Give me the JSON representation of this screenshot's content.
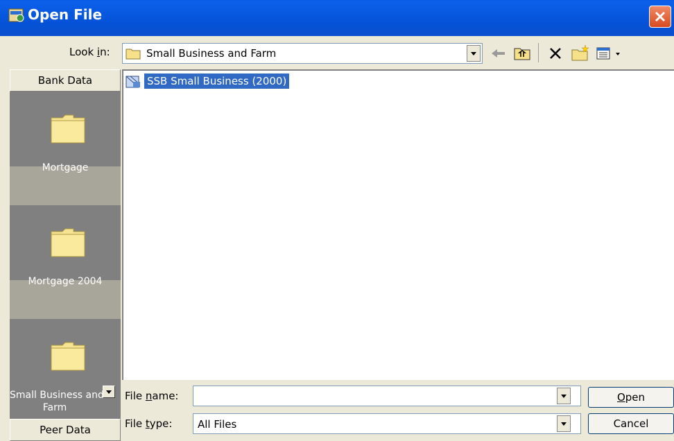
{
  "window": {
    "title": "Open File"
  },
  "look_in": {
    "label_pre": "Look ",
    "label_accel": "i",
    "label_post": "n:",
    "value": "Small Business and Farm"
  },
  "toolbar": {
    "icons": [
      "back-icon",
      "up-folder-icon",
      "delete-icon",
      "new-folder-icon",
      "views-icon"
    ]
  },
  "places_bar": {
    "header": "Bank Data",
    "items": [
      {
        "label": "Mortgage"
      },
      {
        "label": "Mortgage 2004"
      },
      {
        "label_line1": "Small Business and",
        "label_line2": "Farm"
      }
    ],
    "footer": "Peer Data"
  },
  "file_list": {
    "items": [
      {
        "name": "SSB Small Business (2000)",
        "selected": true
      }
    ]
  },
  "file_name": {
    "label_pre": "File ",
    "label_accel": "n",
    "label_post": "ame:",
    "value": ""
  },
  "file_type": {
    "label_pre": "File ",
    "label_accel": "t",
    "label_post": "ype:",
    "value": "All Files"
  },
  "buttons": {
    "open_accel": "O",
    "open_rest": "pen",
    "cancel": "Cancel"
  },
  "colors": {
    "titlebar": "#0553d8",
    "selection": "#316ac5",
    "close": "#d84a20"
  }
}
